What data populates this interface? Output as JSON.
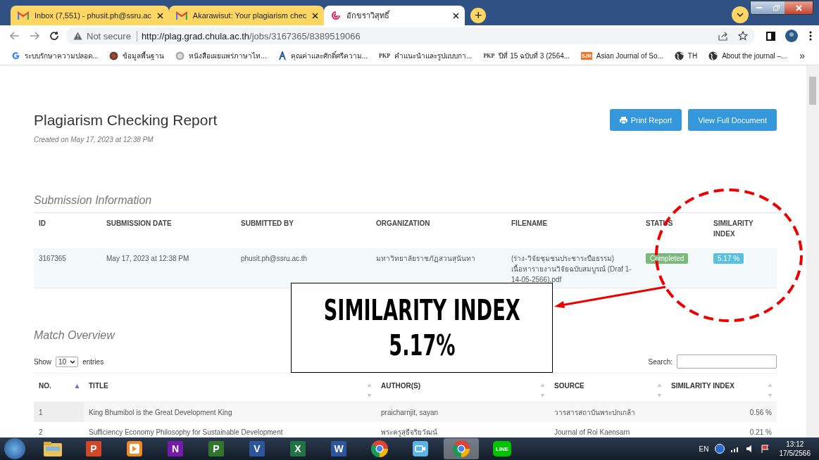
{
  "browser": {
    "tabs": [
      {
        "title": "Inbox (7,551) - phusit.ph@ssru.ac",
        "selected": false
      },
      {
        "title": "Akarawisut: Your plagiarism chec",
        "selected": false
      },
      {
        "title": "อักขราวิสุทธิ์",
        "selected": true
      }
    ],
    "new_tab": "+",
    "address": {
      "security": "Not secure",
      "url_host": "http://plag.grad.chula.ac.th",
      "url_path": "/jobs/3167365/8389519066"
    },
    "bookmarks": [
      {
        "label": "ระบบรักษาความปลอด..."
      },
      {
        "label": "ข้อมูลพื้นฐาน"
      },
      {
        "label": "หนังสือเผยแพร่ภาษาไท..."
      },
      {
        "label": "คุณค่าและศักดิ์ศรีความ..."
      },
      {
        "badge": "PKP",
        "label": "คำแนะนำและรูปแบบกา..."
      },
      {
        "badge": "PKP",
        "label": "ปีที่ 15 ฉบับที่ 3 (2564..."
      },
      {
        "badge": "SJR",
        "label": "Asian Journal of So..."
      },
      {
        "label": "TH"
      },
      {
        "label": "About the journal –..."
      }
    ],
    "bookmarks_more": "»"
  },
  "page": {
    "title": "Plagiarism Checking Report",
    "created": "Created on May 17, 2023 at 12:38 PM",
    "buttons": [
      "Print Report",
      "View Full Document"
    ],
    "submission": {
      "heading": "Submission Information",
      "columns": [
        "ID",
        "SUBMISSION DATE",
        "SUBMITTED BY",
        "ORGANIZATION",
        "FILENAME",
        "STATUS",
        "SIMILARITY INDEX"
      ],
      "rows": [
        {
          "id": "3167365",
          "date": "May 17, 2023 at 12:38 PM",
          "by": "phusit.ph@ssru.ac.th",
          "organization": "มหาวิทยาลัยราชภัฏสวนสุนันทา",
          "filename": "(ร่าง-วิจัยชุมชนประชาระบือธรรม) เนื้อหารายงานวิจัยฉบับสมบูรณ์ (Draf 1-14-05-2566).pdf",
          "status": {
            "label": "Completed",
            "kind": "success"
          },
          "similarity": "5.17 %"
        }
      ]
    },
    "match": {
      "heading": "Match Overview",
      "show_label": "Show",
      "entries_value": "10",
      "entries_label": "entries",
      "search_label": "Search:",
      "columns": [
        {
          "label": "NO.",
          "sorted": true
        },
        {
          "label": "TITLE",
          "sorted": false
        },
        {
          "label": "AUTHOR(S)",
          "sorted": false
        },
        {
          "label": "SOURCE",
          "sorted": false
        },
        {
          "label": "SIMILARITY INDEX",
          "sorted": false
        }
      ],
      "rows": [
        [
          "1",
          "King Bhumibol is the Great Development King",
          "praicharnjit, sayan",
          "วารสารสถาบันพระปกเกล้า",
          "0.56 %"
        ],
        [
          "2",
          "Sufficiency Economy Philosophy for Sustainable Development",
          "พระครูสุธีจริยวัฒน์",
          "Journal of Roi Kaensarn",
          "0.21 %"
        ]
      ]
    }
  },
  "annotation": {
    "lines": [
      "SIMILARITY INDEX",
      "5.17%"
    ]
  },
  "taskbar": {
    "apps": [
      {
        "kind": "explorer",
        "selected": false
      },
      {
        "kind": "office",
        "label": "P",
        "color": "#d24726",
        "selected": false
      },
      {
        "kind": "player",
        "selected": false
      },
      {
        "kind": "office",
        "label": "N",
        "color": "#7719aa",
        "selected": false
      },
      {
        "kind": "office",
        "label": "P",
        "color": "#31752f",
        "selected": false
      },
      {
        "kind": "office",
        "label": "V",
        "color": "#2b579a",
        "selected": false
      },
      {
        "kind": "office",
        "label": "X",
        "color": "#217346",
        "selected": false
      },
      {
        "kind": "office",
        "label": "W",
        "color": "#2b579a",
        "selected": false
      },
      {
        "kind": "chrome",
        "selected": false
      },
      {
        "kind": "camera",
        "selected": false
      },
      {
        "kind": "chrome",
        "selected": true
      },
      {
        "kind": "line",
        "label": "LINE",
        "selected": false
      }
    ],
    "language": "EN",
    "time": "13:12",
    "date": "17/5/2566"
  }
}
